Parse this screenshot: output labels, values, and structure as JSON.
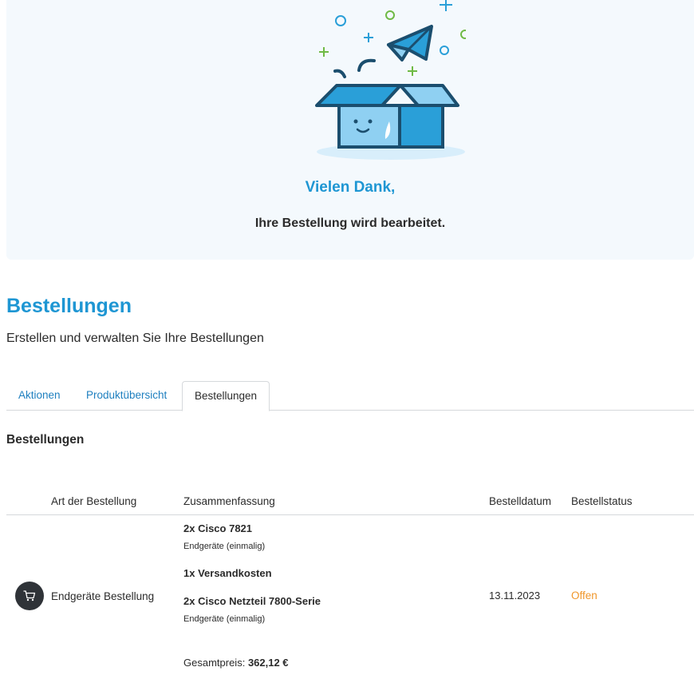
{
  "hero": {
    "title": "Vielen Dank,",
    "subtitle": "Ihre Bestellung wird bearbeitet."
  },
  "page": {
    "title": "Bestellungen",
    "subtitle": "Erstellen und verwalten Sie Ihre Bestellungen"
  },
  "tabs": [
    {
      "label": "Aktionen",
      "active": false
    },
    {
      "label": "Produktübersicht",
      "active": false
    },
    {
      "label": "Bestellungen",
      "active": true
    }
  ],
  "section": {
    "title": "Bestellungen"
  },
  "table": {
    "headers": [
      "Art der Bestellung",
      "Zusammenfassung",
      "Bestelldatum",
      "Bestellstatus"
    ],
    "rows": [
      {
        "icon": "cart-icon",
        "type": "Endgeräte Bestellung",
        "items": [
          {
            "name": "2x Cisco 7821",
            "sub": "Endgeräte (einmalig)"
          },
          {
            "name": "1x Versandkosten",
            "sub": ""
          },
          {
            "name": "2x Cisco Netzteil 7800-Serie",
            "sub": "Endgeräte (einmalig)"
          }
        ],
        "total_label": "Gesamtpreis:",
        "total_value": "362,12 €",
        "date": "13.11.2023",
        "status": "Offen"
      }
    ]
  },
  "colors": {
    "accent": "#1e96d3",
    "status_open": "#f0962a",
    "hero_bg": "#f4f9fd"
  }
}
